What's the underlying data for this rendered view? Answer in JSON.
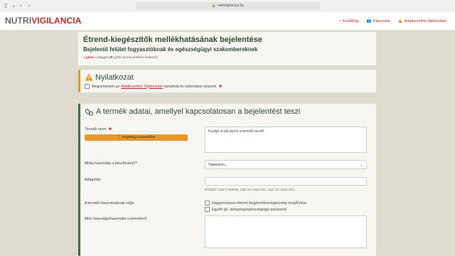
{
  "browser": {
    "url": "nutrivigilancia.hu"
  },
  "logo": {
    "part1": "NUTRI",
    "part2": "VIGILANCIA"
  },
  "nav": {
    "home": "Kezdőlap",
    "contact": "Kapcsolat",
    "privacy": "Adatkezelési tájékoztató"
  },
  "header": {
    "title": "Étrend-kiegészítők mellékhatásának bejelentése",
    "subtitle": "Bejelentő felület fogyasztóknak és egészségügyi szakembereknek",
    "note_prefix": "A ",
    "note_red": "piros",
    "note_suffix": " csillaggal (✱) jelölt mezők kitöltése kötelező!"
  },
  "disclaimer": {
    "title": "Nyilatkozat",
    "text_before": "Megismertem az",
    "link": "Adatkezelési Tájékoztató",
    "text_after": "tartalmát és tudomásul veszem."
  },
  "product": {
    "title": "A termék adatai, amellyel kapcsolatosan a bejelentést teszi",
    "name_label": "Termék neve:",
    "help_button": "Segítség a keresőhöz",
    "name_placeholder": "Kezdje el ide beírni a termék nevét!",
    "since_label": "Mióta használja a készítményt?",
    "since_value": "Válasszon...",
    "dose_label": "Adagolás:",
    "dose_hint": "(Például: napi 1 tabletta, napi 2x1 kapszula, napi 10 csepp stb.)",
    "purpose_label": "A termék használatának célja:",
    "purpose_opt1": "Hagyományos étrend kiegészítése/egészség megőrzése",
    "purpose_opt2": "Egyéb (pl. betegség/egészségügyi panaszok",
    "reason_label": "Mire használja/használta a terméket?"
  }
}
